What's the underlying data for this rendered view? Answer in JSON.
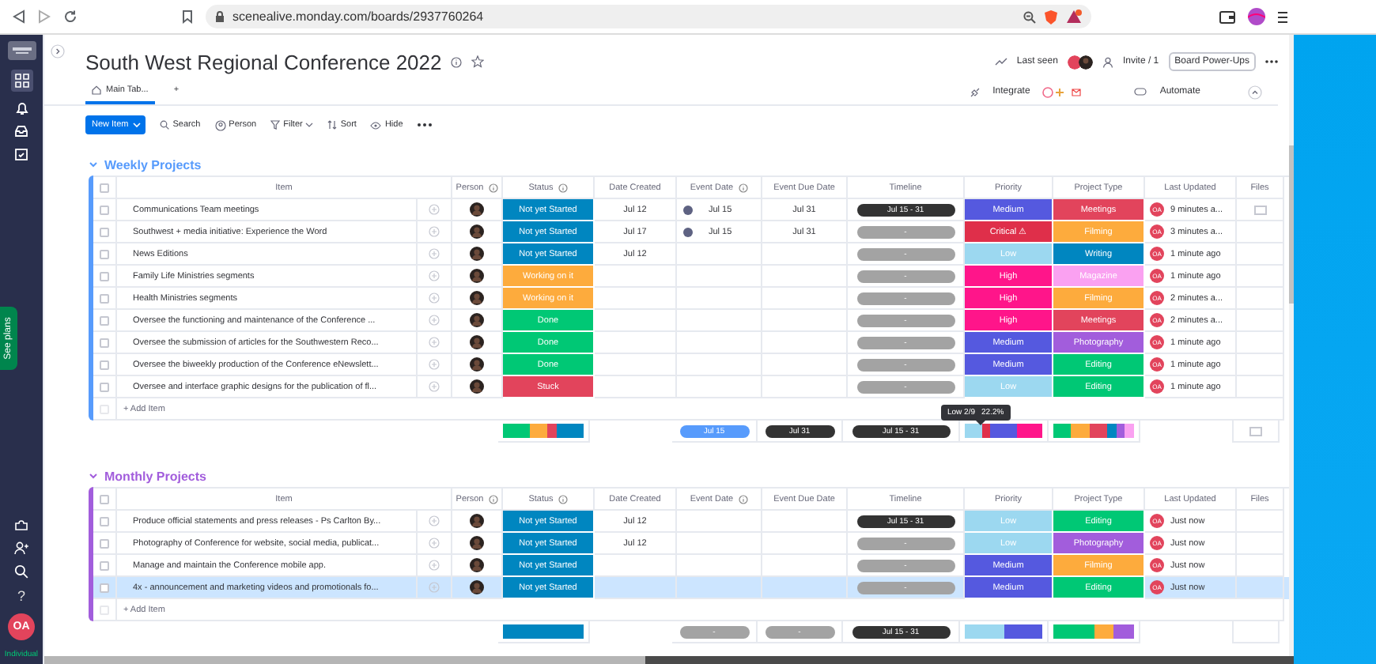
{
  "browser": {
    "url": "scenealive.monday.com/boards/2937760264"
  },
  "sidebar": {
    "see_plans": "See plans",
    "help": "?",
    "avatar": "OA",
    "plan": "Individual"
  },
  "board": {
    "title": "South West Regional Conference 2022",
    "last_seen": "Last seen",
    "invite": "Invite / 1",
    "power_ups": "Board Power-Ups",
    "integrate": "Integrate",
    "automate": "Automate",
    "tabs": [
      {
        "label": "Main Tab...",
        "selected": true
      },
      {
        "label": "+",
        "selected": false
      }
    ]
  },
  "toolbar": {
    "new_item": "New Item",
    "tools": [
      {
        "kind": "search",
        "label": "Search"
      },
      {
        "kind": "person",
        "label": "Person"
      },
      {
        "kind": "filter",
        "label": "Filter"
      },
      {
        "kind": "sort",
        "label": "Sort"
      },
      {
        "kind": "hide",
        "label": "Hide"
      }
    ]
  },
  "groups": [
    {
      "title": "Weekly Projects",
      "color": "#579bfc",
      "all_checked": false,
      "columns": [
        {
          "label": "Item",
          "info": false
        },
        {
          "label": "Person",
          "info": true
        },
        {
          "label": "Status",
          "info": true
        },
        {
          "label": "Date Created",
          "info": false
        },
        {
          "label": "Event Date",
          "info": true
        },
        {
          "label": "Event Due Date",
          "info": false
        },
        {
          "label": "Timeline",
          "info": false
        },
        {
          "label": "Priority",
          "info": false
        },
        {
          "label": "Project Type",
          "info": false
        },
        {
          "label": "Last Updated",
          "info": false
        },
        {
          "label": "Files",
          "info": false
        }
      ],
      "rows": [
        {
          "item": "Communications Team meetings",
          "status": {
            "label": "Not yet Started",
            "color": "#0086c0"
          },
          "date_created": "Jul 12",
          "event_date": "Jul 15",
          "due_date": "Jul 31",
          "timeline": {
            "label": "Jul 15 - 31",
            "set": true
          },
          "priority": {
            "label": "Medium",
            "color": "#5559df"
          },
          "project_type": {
            "label": "Meetings",
            "color": "#e2445c"
          },
          "updated_by": "OA",
          "last_updated": "9 minutes a...",
          "files": true,
          "checked": false,
          "selected": false
        },
        {
          "item": "Southwest + media initiative: Experience the Word",
          "status": {
            "label": "Not yet Started",
            "color": "#0086c0"
          },
          "date_created": "Jul 17",
          "event_date": "Jul 15",
          "due_date": "Jul 31",
          "timeline": {
            "label": "-",
            "set": false
          },
          "priority": {
            "label": "Critical ⚠",
            "color": "#df2f4a"
          },
          "project_type": {
            "label": "Filming",
            "color": "#fdab3d"
          },
          "updated_by": "OA",
          "last_updated": "3 minutes a...",
          "files": false,
          "checked": false,
          "selected": false
        },
        {
          "item": "News Editions",
          "status": {
            "label": "Not yet Started",
            "color": "#0086c0"
          },
          "date_created": "Jul 12",
          "timeline": {
            "label": "-",
            "set": false
          },
          "priority": {
            "label": "Low",
            "color": "#9cd8f0"
          },
          "project_type": {
            "label": "Writing",
            "color": "#0086c0"
          },
          "updated_by": "OA",
          "last_updated": "1 minute ago",
          "files": false,
          "checked": false,
          "selected": false
        },
        {
          "item": "Family Life Ministries segments",
          "status": {
            "label": "Working on it",
            "color": "#fdab3d"
          },
          "timeline": {
            "label": "-",
            "set": false
          },
          "priority": {
            "label": "High",
            "color": "#ff158a"
          },
          "project_type": {
            "label": "Magazine",
            "color": "#faa1f1"
          },
          "updated_by": "OA",
          "last_updated": "1 minute ago",
          "files": false,
          "checked": false,
          "selected": false
        },
        {
          "item": "Health Ministries segments",
          "status": {
            "label": "Working on it",
            "color": "#fdab3d"
          },
          "timeline": {
            "label": "-",
            "set": false
          },
          "priority": {
            "label": "High",
            "color": "#ff158a"
          },
          "project_type": {
            "label": "Filming",
            "color": "#fdab3d"
          },
          "updated_by": "OA",
          "last_updated": "2 minutes a...",
          "files": false,
          "checked": false,
          "selected": false
        },
        {
          "item": "Oversee the functioning and maintenance of the Conference ...",
          "status": {
            "label": "Done",
            "color": "#00c875"
          },
          "timeline": {
            "label": "-",
            "set": false
          },
          "priority": {
            "label": "High",
            "color": "#ff158a"
          },
          "project_type": {
            "label": "Meetings",
            "color": "#e2445c"
          },
          "updated_by": "OA",
          "last_updated": "2 minutes a...",
          "files": false,
          "checked": false,
          "selected": false
        },
        {
          "item": "Oversee the submission of articles for the Southwestern Reco...",
          "status": {
            "label": "Done",
            "color": "#00c875"
          },
          "timeline": {
            "label": "-",
            "set": false
          },
          "priority": {
            "label": "Medium",
            "color": "#5559df"
          },
          "project_type": {
            "label": "Photography",
            "color": "#a25ddc"
          },
          "updated_by": "OA",
          "last_updated": "1 minute ago",
          "files": false,
          "checked": false,
          "selected": false
        },
        {
          "item": "Oversee the biweekly production of the Conference eNewslett...",
          "status": {
            "label": "Done",
            "color": "#00c875"
          },
          "timeline": {
            "label": "-",
            "set": false
          },
          "priority": {
            "label": "Medium",
            "color": "#5559df"
          },
          "project_type": {
            "label": "Editing",
            "color": "#00c875"
          },
          "updated_by": "OA",
          "last_updated": "1 minute ago",
          "files": false,
          "checked": false,
          "selected": false
        },
        {
          "item": "Oversee and interface graphic designs for the publication of fl...",
          "status": {
            "label": "Stuck",
            "color": "#e2445c"
          },
          "timeline": {
            "label": "-",
            "set": false
          },
          "priority": {
            "label": "Low",
            "color": "#9cd8f0"
          },
          "project_type": {
            "label": "Editing",
            "color": "#00c875"
          },
          "updated_by": "OA",
          "last_updated": "1 minute ago",
          "files": false,
          "checked": false,
          "selected": false
        }
      ],
      "add_item": "+ Add Item",
      "summary": {
        "status_segments": [
          {
            "color": "#00c875"
          },
          {
            "color": "#fdab3d"
          },
          {
            "color": "#e2445c"
          },
          {
            "color": "#0086c0"
          }
        ],
        "event": {
          "label": "Jul 15",
          "set": true
        },
        "due": {
          "label": "Jul 31",
          "set": true
        },
        "timeline": {
          "label": "Jul 15 - 31",
          "set": true
        },
        "priority_segments": [
          {
            "color": "#9cd8f0"
          },
          {
            "color": "#df2f4a"
          },
          {
            "color": "#5559df"
          },
          {
            "color": "#ff158a"
          }
        ],
        "type_segments": [
          {
            "color": "#00c875"
          },
          {
            "color": "#fdab3d"
          },
          {
            "color": "#e2445c"
          },
          {
            "color": "#0086c0"
          },
          {
            "color": "#a25ddc"
          },
          {
            "color": "#faa1f1"
          }
        ],
        "files": true,
        "tooltip": {
          "label": "Low 2/9",
          "percent": "22.2%"
        }
      }
    },
    {
      "title": "Monthly Projects",
      "color": "#a25ddc",
      "all_checked": false,
      "columns": [
        {
          "label": "Item",
          "info": false
        },
        {
          "label": "Person",
          "info": true
        },
        {
          "label": "Status",
          "info": true
        },
        {
          "label": "Date Created",
          "info": false
        },
        {
          "label": "Event Date",
          "info": true
        },
        {
          "label": "Event Due Date",
          "info": false
        },
        {
          "label": "Timeline",
          "info": false
        },
        {
          "label": "Priority",
          "info": false
        },
        {
          "label": "Project Type",
          "info": false
        },
        {
          "label": "Last Updated",
          "info": false
        },
        {
          "label": "Files",
          "info": false
        }
      ],
      "rows": [
        {
          "item": "Produce official statements and press releases - Ps Carlton By...",
          "status": {
            "label": "Not yet Started",
            "color": "#0086c0"
          },
          "date_created": "Jul 12",
          "timeline": {
            "label": "Jul 15 - 31",
            "set": true
          },
          "priority": {
            "label": "Low",
            "color": "#9cd8f0"
          },
          "project_type": {
            "label": "Editing",
            "color": "#00c875"
          },
          "updated_by": "OA",
          "last_updated": "Just now",
          "files": false,
          "checked": false,
          "selected": false
        },
        {
          "item": "Photography of Conference for website, social media, publicat...",
          "status": {
            "label": "Not yet Started",
            "color": "#0086c0"
          },
          "date_created": "Jul 12",
          "timeline": {
            "label": "-",
            "set": false
          },
          "priority": {
            "label": "Low",
            "color": "#9cd8f0"
          },
          "project_type": {
            "label": "Photography",
            "color": "#a25ddc"
          },
          "updated_by": "OA",
          "last_updated": "Just now",
          "files": false,
          "checked": false,
          "selected": false
        },
        {
          "item": "Manage and maintain the Conference mobile app.",
          "status": {
            "label": "Not yet Started",
            "color": "#0086c0"
          },
          "timeline": {
            "label": "-",
            "set": false
          },
          "priority": {
            "label": "Medium",
            "color": "#5559df"
          },
          "project_type": {
            "label": "Filming",
            "color": "#fdab3d"
          },
          "updated_by": "OA",
          "last_updated": "Just now",
          "files": false,
          "checked": false,
          "selected": false
        },
        {
          "item": "4x - announcement and marketing videos and promotionals fo...",
          "status": {
            "label": "Not yet Started",
            "color": "#0086c0"
          },
          "timeline": {
            "label": "-",
            "set": false
          },
          "priority": {
            "label": "Medium",
            "color": "#5559df"
          },
          "project_type": {
            "label": "Editing",
            "color": "#00c875"
          },
          "updated_by": "OA",
          "last_updated": "Just now",
          "files": false,
          "checked": false,
          "selected": true
        }
      ],
      "add_item": "+ Add Item",
      "summary": {
        "status_segments": [
          {
            "color": "#0086c0"
          }
        ],
        "event": {
          "label": "-",
          "set": false
        },
        "due": {
          "label": "-",
          "set": false
        },
        "timeline": {
          "label": "Jul 15 - 31",
          "set": true
        },
        "priority_segments": [
          {
            "color": "#9cd8f0"
          },
          {
            "color": "#5559df"
          }
        ],
        "type_segments": [
          {
            "color": "#00c875"
          },
          {
            "color": "#fdab3d"
          },
          {
            "color": "#a25ddc"
          }
        ],
        "files": false
      }
    }
  ]
}
